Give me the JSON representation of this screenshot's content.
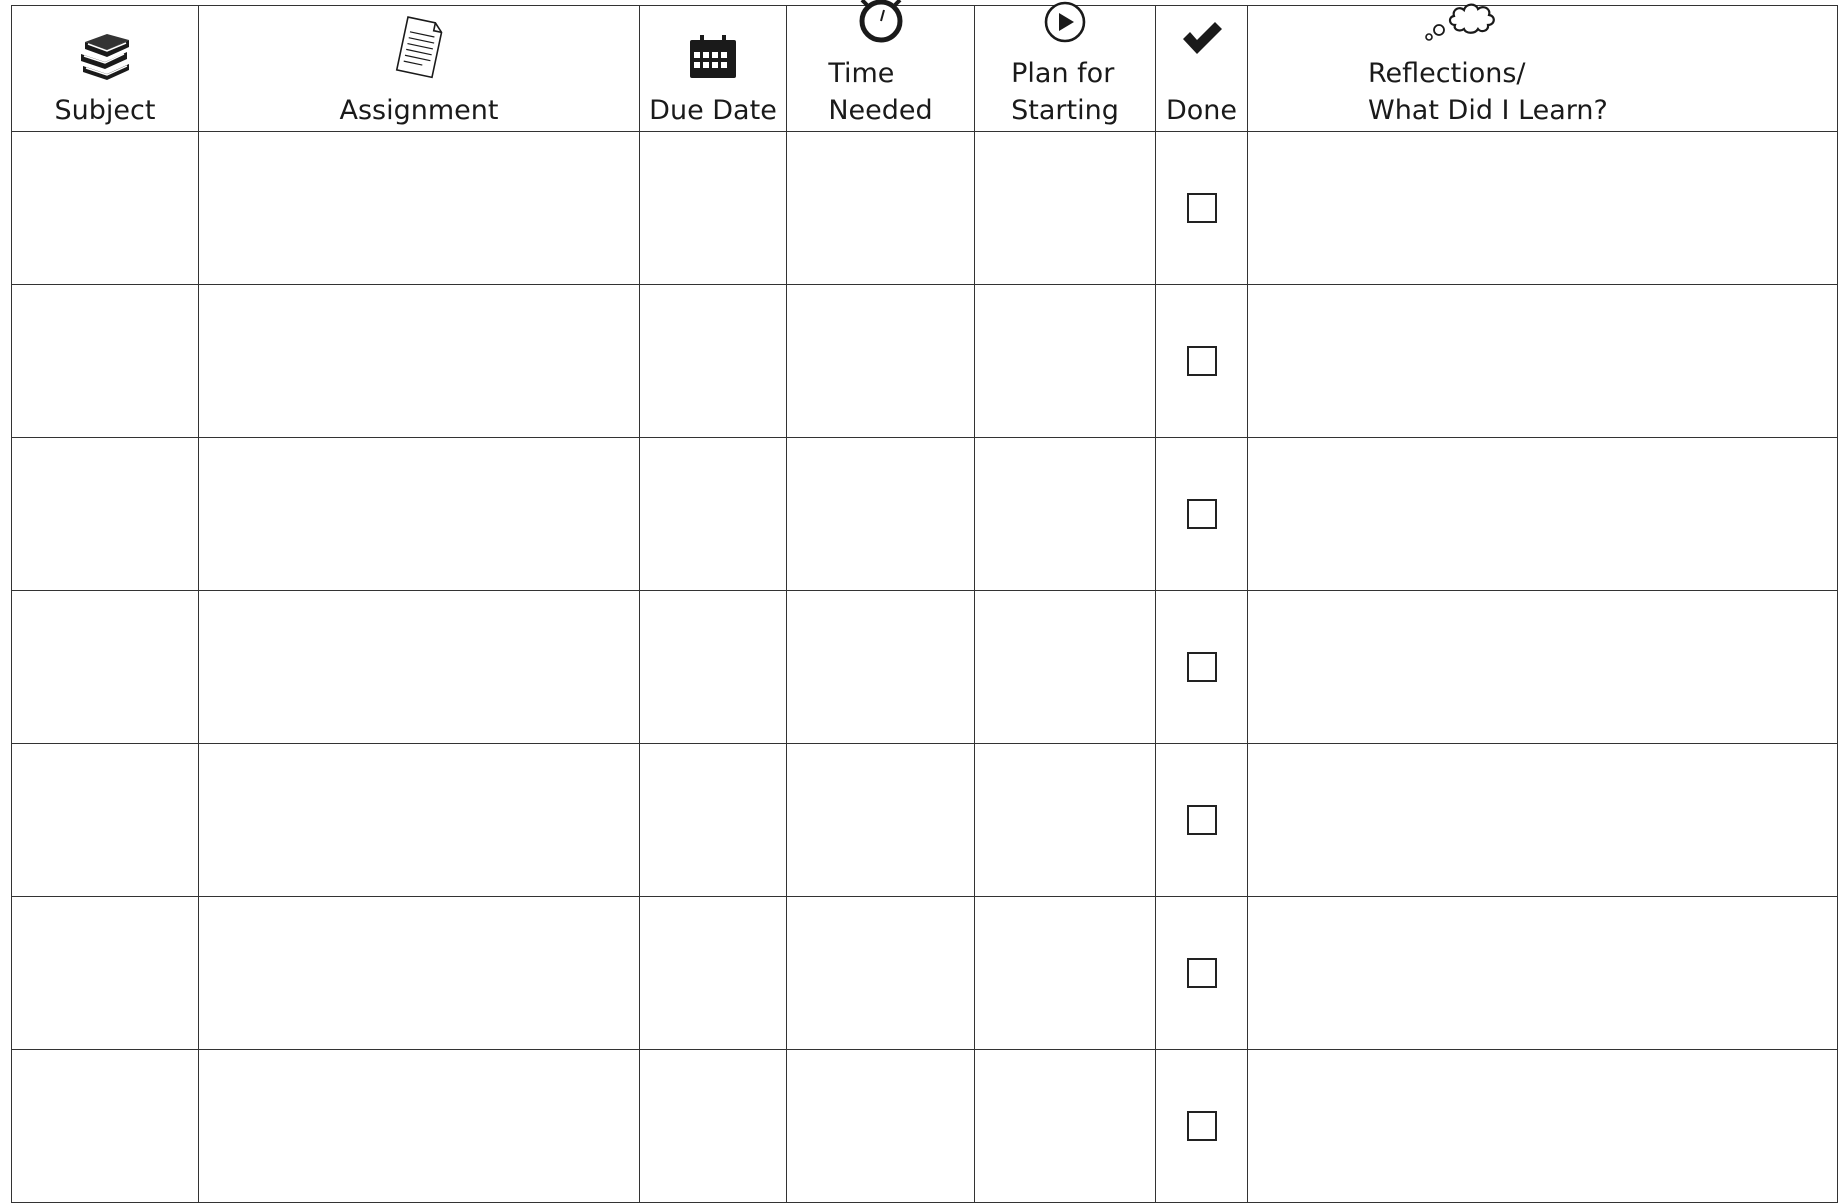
{
  "columns": {
    "subject": {
      "label": "Subject",
      "icon": "books-icon"
    },
    "assignment": {
      "label": "Assignment",
      "icon": "document-icon"
    },
    "due_date": {
      "label": "Due Date",
      "icon": "calendar-icon"
    },
    "time_needed": {
      "label_line1": "Time",
      "label_line2": "Needed",
      "icon": "stopwatch-icon"
    },
    "plan_for_starting": {
      "label_line1": "Plan for",
      "label_line2": "Starting",
      "icon": "play-icon"
    },
    "done": {
      "label": "Done",
      "icon": "checkmark-icon"
    },
    "reflections": {
      "label_line1": "Reflections/",
      "label_line2": "What Did I Learn?",
      "icon": "thought-bubble-icon"
    }
  },
  "rows": [
    {
      "subject": "",
      "assignment": "",
      "due_date": "",
      "time_needed": "",
      "plan_for_starting": "",
      "done": false,
      "reflections": ""
    },
    {
      "subject": "",
      "assignment": "",
      "due_date": "",
      "time_needed": "",
      "plan_for_starting": "",
      "done": false,
      "reflections": ""
    },
    {
      "subject": "",
      "assignment": "",
      "due_date": "",
      "time_needed": "",
      "plan_for_starting": "",
      "done": false,
      "reflections": ""
    },
    {
      "subject": "",
      "assignment": "",
      "due_date": "",
      "time_needed": "",
      "plan_for_starting": "",
      "done": false,
      "reflections": ""
    },
    {
      "subject": "",
      "assignment": "",
      "due_date": "",
      "time_needed": "",
      "plan_for_starting": "",
      "done": false,
      "reflections": ""
    },
    {
      "subject": "",
      "assignment": "",
      "due_date": "",
      "time_needed": "",
      "plan_for_starting": "",
      "done": false,
      "reflections": ""
    },
    {
      "subject": "",
      "assignment": "",
      "due_date": "",
      "time_needed": "",
      "plan_for_starting": "",
      "done": false,
      "reflections": ""
    }
  ],
  "colors": {
    "line": "#333333",
    "ink": "#1a1a1a",
    "background": "#ffffff"
  }
}
